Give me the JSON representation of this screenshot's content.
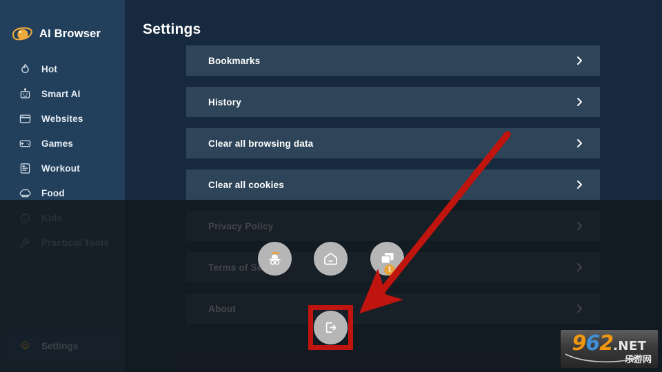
{
  "app": {
    "brand_name": "AI Browser",
    "brand_icon": "planet-saturn-icon"
  },
  "sidebar": {
    "items": [
      {
        "label": "Hot",
        "icon": "flame-icon",
        "state": "normal"
      },
      {
        "label": "Smart AI",
        "icon": "robot-icon",
        "state": "normal"
      },
      {
        "label": "Websites",
        "icon": "browser-window-icon",
        "state": "normal"
      },
      {
        "label": "Games",
        "icon": "gamepad-icon",
        "state": "normal"
      },
      {
        "label": "Workout",
        "icon": "document-list-icon",
        "state": "normal"
      },
      {
        "label": "Food",
        "icon": "chef-hat-icon",
        "state": "normal"
      },
      {
        "label": "Kids",
        "icon": "baby-face-icon",
        "state": "dimmed"
      },
      {
        "label": "Practical Tools",
        "icon": "wrench-icon",
        "state": "dimmed"
      }
    ],
    "settings": {
      "label": "Settings",
      "icon": "gear-icon"
    }
  },
  "main": {
    "title": "Settings",
    "rows": [
      {
        "label": "Bookmarks",
        "chevron": "chevron-right-icon"
      },
      {
        "label": "History",
        "chevron": "chevron-right-icon"
      },
      {
        "label": "Clear all browsing data",
        "chevron": "chevron-right-icon"
      },
      {
        "label": "Clear all cookies",
        "chevron": "chevron-right-icon"
      },
      {
        "label": "Privacy Policy",
        "chevron": "chevron-right-icon"
      },
      {
        "label": "Terms of Service",
        "chevron": "chevron-right-icon"
      },
      {
        "label": "About",
        "chevron": "chevron-right-icon"
      }
    ]
  },
  "floating_buttons": {
    "incognito": {
      "name": "incognito-mode-button",
      "icon": "incognito-icon"
    },
    "home": {
      "name": "home-button",
      "icon": "home-icon"
    },
    "tabs": {
      "name": "tabs-button",
      "icon": "tabs-icon",
      "badge_count": "1"
    },
    "exit": {
      "name": "exit-button",
      "icon": "exit-arrow-icon"
    }
  },
  "annotation": {
    "highlight_target": "exit-button",
    "arrow_color": "#c0150f",
    "highlight_color": "#c0150f"
  },
  "watermark": {
    "digit_9": "9",
    "digit_6": "6",
    "digit_2": "2",
    "tld": ".NET",
    "chinese": "乐游网"
  },
  "colors": {
    "sidebar_bg": "#22405c",
    "main_bg": "#16293f",
    "row_bg": "#2e4458",
    "accent_orange": "#e8a33d",
    "fab_bg": "#b6b6b6",
    "text_primary": "#ffffff"
  }
}
